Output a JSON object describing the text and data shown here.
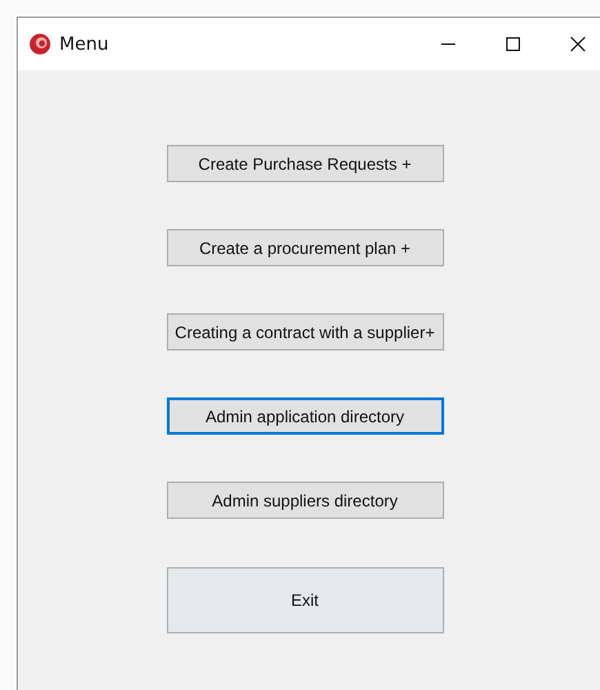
{
  "window": {
    "title": "Menu"
  },
  "buttons": [
    {
      "label": "Create Purchase Requests +",
      "kind": "normal",
      "focused": false
    },
    {
      "label": "Create a procurement plan +",
      "kind": "normal",
      "focused": false
    },
    {
      "label": "Creating a contract with a supplier+",
      "kind": "normal",
      "focused": false
    },
    {
      "label": "Admin application directory",
      "kind": "normal",
      "focused": true
    },
    {
      "label": "Admin suppliers directory",
      "kind": "normal",
      "focused": false
    },
    {
      "label": "Exit",
      "kind": "large",
      "focused": false
    }
  ]
}
